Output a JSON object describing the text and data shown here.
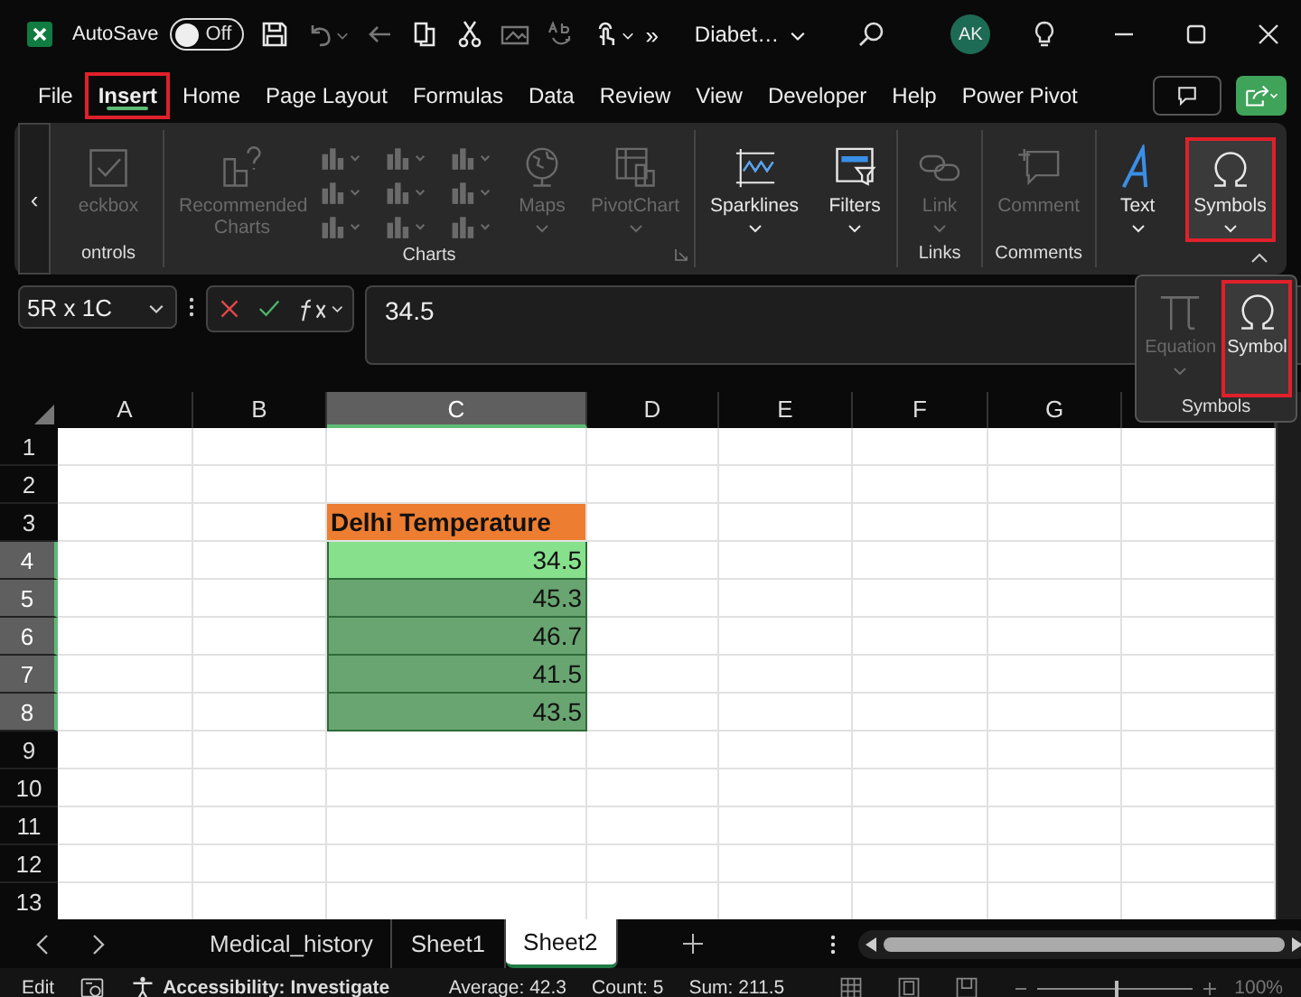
{
  "title_bar": {
    "autosave_label": "AutoSave",
    "autosave_toggle": {
      "on": false,
      "label": "Off"
    },
    "quick_access": [
      {
        "kind": "save",
        "disabled": false,
        "dropdown": false
      },
      {
        "kind": "undo",
        "disabled": true,
        "dropdown": true
      },
      {
        "kind": "back",
        "disabled": true,
        "dropdown": false
      },
      {
        "kind": "copy",
        "disabled": false,
        "dropdown": false
      },
      {
        "kind": "cut",
        "disabled": false,
        "dropdown": false
      },
      {
        "kind": "picture",
        "disabled": true,
        "dropdown": false
      },
      {
        "kind": "spelling",
        "disabled": true,
        "dropdown": false
      },
      {
        "kind": "touch",
        "disabled": false,
        "dropdown": true
      }
    ],
    "overflow": "»",
    "file_name": "Diabet…",
    "avatar": "AK"
  },
  "menu_tabs": [
    {
      "label": "File",
      "selected": false,
      "highlighted": false
    },
    {
      "label": "Insert",
      "selected": true,
      "highlighted": true
    },
    {
      "label": "Home",
      "selected": false,
      "highlighted": false
    },
    {
      "label": "Page Layout",
      "selected": false,
      "highlighted": false
    },
    {
      "label": "Formulas",
      "selected": false,
      "highlighted": false
    },
    {
      "label": "Data",
      "selected": false,
      "highlighted": false
    },
    {
      "label": "Review",
      "selected": false,
      "highlighted": false
    },
    {
      "label": "View",
      "selected": false,
      "highlighted": false
    },
    {
      "label": "Developer",
      "selected": false,
      "highlighted": false
    },
    {
      "label": "Help",
      "selected": false,
      "highlighted": false
    },
    {
      "label": "Power Pivot",
      "selected": false,
      "highlighted": false
    }
  ],
  "ribbon": {
    "scroll_left": "‹",
    "groups": [
      {
        "label": "ontrols",
        "items": [
          {
            "kind": "checkbox",
            "label": "eckbox",
            "disabled": true,
            "dropdown": false,
            "highlighted": false
          }
        ]
      },
      {
        "label": "Charts",
        "launcher": true,
        "items": [
          {
            "kind": "recommended",
            "label": "Recommended Charts",
            "disabled": true,
            "dropdown": false,
            "highlighted": false
          },
          {
            "kind": "gallery",
            "disabled": true
          },
          {
            "kind": "maps",
            "label": "Maps",
            "disabled": true,
            "dropdown": true,
            "highlighted": false
          },
          {
            "kind": "pivotchart",
            "label": "PivotChart",
            "disabled": true,
            "dropdown": true,
            "highlighted": false
          }
        ]
      },
      {
        "items": [
          {
            "kind": "sparklines",
            "label": "Sparklines",
            "disabled": false,
            "dropdown": true,
            "highlighted": false
          }
        ]
      },
      {
        "items": [
          {
            "kind": "filters",
            "label": "Filters",
            "disabled": false,
            "dropdown": true,
            "highlighted": false
          }
        ]
      },
      {
        "label": "Links",
        "items": [
          {
            "kind": "link",
            "label": "Link",
            "disabled": true,
            "dropdown": true,
            "highlighted": false
          }
        ]
      },
      {
        "label": "Comments",
        "items": [
          {
            "kind": "comment",
            "label": "Comment",
            "disabled": true,
            "dropdown": false,
            "highlighted": false
          }
        ]
      },
      {
        "items": [
          {
            "kind": "text",
            "label": "Text",
            "disabled": false,
            "dropdown": true,
            "highlighted": false
          }
        ]
      },
      {
        "items": [
          {
            "kind": "omega",
            "label": "Symbols",
            "disabled": false,
            "dropdown": true,
            "highlighted": true
          }
        ]
      }
    ]
  },
  "symbols_popup": {
    "label": "Symbols",
    "items": [
      {
        "kind": "pi",
        "label": "Equation",
        "disabled": true,
        "dropdown": true,
        "highlighted": false
      },
      {
        "kind": "omega",
        "label": "Symbol",
        "disabled": false,
        "dropdown": false,
        "highlighted": true
      }
    ]
  },
  "formula_bar": {
    "name_box": "5R x 1C",
    "value": "34.5"
  },
  "grid": {
    "columns": [
      {
        "label": "A",
        "selected": false
      },
      {
        "label": "B",
        "selected": false
      },
      {
        "label": "C",
        "selected": true
      },
      {
        "label": "D",
        "selected": false
      },
      {
        "label": "E",
        "selected": false
      },
      {
        "label": "F",
        "selected": false
      },
      {
        "label": "G",
        "selected": false
      }
    ],
    "rows": [
      {
        "label": "1",
        "selected": false,
        "cells": []
      },
      {
        "label": "2",
        "selected": false,
        "cells": []
      },
      {
        "label": "3",
        "selected": false,
        "cells": [
          null,
          null,
          {
            "text": "Delhi Temperature",
            "kind": "title",
            "active": false
          }
        ]
      },
      {
        "label": "4",
        "selected": true,
        "cells": [
          null,
          null,
          {
            "text": "34.5",
            "kind": "number",
            "active": true
          }
        ]
      },
      {
        "label": "5",
        "selected": true,
        "cells": [
          null,
          null,
          {
            "text": "45.3",
            "kind": "number",
            "active": false
          }
        ]
      },
      {
        "label": "6",
        "selected": true,
        "cells": [
          null,
          null,
          {
            "text": "46.7",
            "kind": "number",
            "active": false
          }
        ]
      },
      {
        "label": "7",
        "selected": true,
        "cells": [
          null,
          null,
          {
            "text": "41.5",
            "kind": "number",
            "active": false
          }
        ]
      },
      {
        "label": "8",
        "selected": true,
        "cells": [
          null,
          null,
          {
            "text": "43.5",
            "kind": "number",
            "active": false
          }
        ]
      },
      {
        "label": "9",
        "selected": false,
        "cells": []
      },
      {
        "label": "10",
        "selected": false,
        "cells": []
      },
      {
        "label": "11",
        "selected": false,
        "cells": []
      },
      {
        "label": "12",
        "selected": false,
        "cells": []
      },
      {
        "label": "13",
        "selected": false,
        "cells": []
      }
    ]
  },
  "sheet_tabs": [
    {
      "label": "Medical_history",
      "selected": false
    },
    {
      "label": "Sheet1",
      "selected": false
    },
    {
      "label": "Sheet2",
      "selected": true
    }
  ],
  "status_bar": {
    "mode": "Edit",
    "accessibility": "Accessibility: Investigate",
    "average": "Average: 42.3",
    "count": "Count: 5",
    "sum": "Sum: 211.5",
    "zoom": {
      "level": 0.5,
      "label": "100%"
    }
  }
}
